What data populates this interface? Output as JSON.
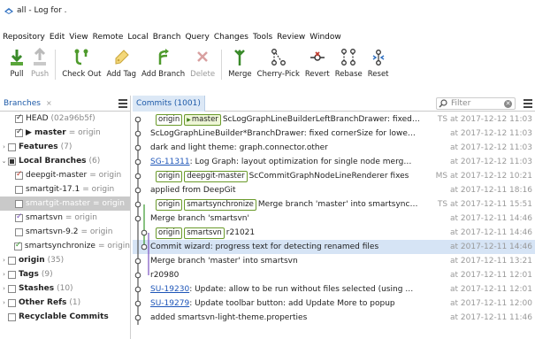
{
  "window": {
    "title": "all - Log for ."
  },
  "menu": [
    "Repository",
    "Edit",
    "View",
    "Remote",
    "Local",
    "Branch",
    "Query",
    "Changes",
    "Tools",
    "Review",
    "Window"
  ],
  "toolbar": [
    {
      "label": "Pull",
      "icon": "pull-icon",
      "disabled": false
    },
    {
      "label": "Push",
      "icon": "push-icon",
      "disabled": true
    },
    {
      "label": "Check Out",
      "icon": "checkout-icon",
      "disabled": false
    },
    {
      "label": "Add Tag",
      "icon": "tag-icon",
      "disabled": false
    },
    {
      "label": "Add Branch",
      "icon": "branch-icon",
      "disabled": false
    },
    {
      "label": "Delete",
      "icon": "delete-icon",
      "disabled": true
    },
    {
      "label": "Merge",
      "icon": "merge-icon",
      "disabled": false
    },
    {
      "label": "Cherry-Pick",
      "icon": "cherry-pick-icon",
      "disabled": false
    },
    {
      "label": "Revert",
      "icon": "revert-icon",
      "disabled": false
    },
    {
      "label": "Rebase",
      "icon": "rebase-icon",
      "disabled": false
    },
    {
      "label": "Reset",
      "icon": "reset-icon",
      "disabled": false
    }
  ],
  "branches": {
    "tab_label": "Branches",
    "close": "×",
    "items": [
      {
        "arrow": "",
        "check": "on",
        "color": "",
        "name": "HEAD",
        "sub": "(02a96b5f)",
        "bold": false,
        "indent": 1
      },
      {
        "arrow": "",
        "check": "on",
        "color": "",
        "name": "▶ master",
        "sub": "= origin",
        "bold": true,
        "indent": 1
      },
      {
        "arrow": "›",
        "check": "off",
        "color": "",
        "name": "Features",
        "sub": "(7)",
        "bold": true,
        "indent": 0
      },
      {
        "arrow": "⌄",
        "check": "mixed",
        "color": "",
        "name": "Local Branches",
        "sub": "(6)",
        "bold": true,
        "indent": 0
      },
      {
        "arrow": "",
        "check": "on",
        "color": "red",
        "name": "deepgit-master",
        "sub": "= origin",
        "bold": false,
        "indent": 1
      },
      {
        "arrow": "",
        "check": "off",
        "color": "",
        "name": "smartgit-17.1",
        "sub": "= origin",
        "bold": false,
        "indent": 1
      },
      {
        "arrow": "",
        "check": "off",
        "color": "",
        "name": "smartgit-master",
        "sub": "= origin",
        "bold": false,
        "indent": 1,
        "selected": true
      },
      {
        "arrow": "",
        "check": "on",
        "color": "purple",
        "name": "smartsvn",
        "sub": "= origin",
        "bold": false,
        "indent": 1
      },
      {
        "arrow": "",
        "check": "off",
        "color": "",
        "name": "smartsvn-9.2",
        "sub": "= origin",
        "bold": false,
        "indent": 1
      },
      {
        "arrow": "",
        "check": "on",
        "color": "green",
        "name": "smartsynchronize",
        "sub": "= origin",
        "bold": false,
        "indent": 1
      },
      {
        "arrow": "›",
        "check": "off",
        "color": "",
        "name": "origin",
        "sub": "(35)",
        "bold": true,
        "indent": 0
      },
      {
        "arrow": "›",
        "check": "off",
        "color": "",
        "name": "Tags",
        "sub": "(9)",
        "bold": true,
        "indent": 0
      },
      {
        "arrow": "›",
        "check": "off",
        "color": "",
        "name": "Stashes",
        "sub": "(10)",
        "bold": true,
        "indent": 0
      },
      {
        "arrow": "›",
        "check": "off",
        "color": "",
        "name": "Other Refs",
        "sub": "(1)",
        "bold": true,
        "indent": 0
      },
      {
        "arrow": "",
        "check": "off",
        "color": "",
        "name": "Recyclable Commits",
        "sub": "",
        "bold": true,
        "indent": 0
      }
    ]
  },
  "commits": {
    "tab_label": "Commits (1001)",
    "filter_placeholder": "Filter",
    "rows": [
      {
        "refs": [
          {
            "t": "origin",
            "c": false
          },
          {
            "t": "master",
            "c": true
          }
        ],
        "id": "",
        "msg": "ScLogGraphLineBuilderLeftBranchDrawer: fixed size on Linux",
        "when": "TS at 2017-12-12 11:03",
        "hl": false
      },
      {
        "refs": [],
        "id": "",
        "msg": "ScLogGraphLineBuilder*BranchDrawer: fixed cornerSize for lower resolutions",
        "when": "at 2017-12-12 11:03",
        "hl": false
      },
      {
        "refs": [],
        "id": "",
        "msg": "dark and light theme: graph.connector.other",
        "when": "at 2017-12-12 11:03",
        "hl": false
      },
      {
        "refs": [],
        "id": "SG-11311",
        "msg": ": Log Graph: layout optimization for single node merge-forks",
        "when": "at 2017-12-12 11:03",
        "hl": false
      },
      {
        "refs": [
          {
            "t": "origin",
            "c": false
          },
          {
            "t": "deepgit-master",
            "c": false
          }
        ],
        "id": "",
        "msg": "ScCommitGraphNodeLineRenderer fixes",
        "when": "MS at 2017-12-12 10:21",
        "hl": false
      },
      {
        "refs": [],
        "id": "",
        "msg": "applied from DeepGit",
        "when": "at 2017-12-11 18:16",
        "hl": false
      },
      {
        "refs": [
          {
            "t": "origin",
            "c": false
          },
          {
            "t": "smartsynchronize",
            "c": false
          }
        ],
        "id": "",
        "msg": "Merge branch 'master' into smartsynchronize (r15463)",
        "when": "TS at 2017-12-11 15:51",
        "hl": false
      },
      {
        "refs": [],
        "id": "",
        "msg": "Merge branch 'smartsvn'",
        "when": "at 2017-12-11 14:46",
        "hl": false
      },
      {
        "refs": [
          {
            "t": "origin",
            "c": false
          },
          {
            "t": "smartsvn",
            "c": false
          }
        ],
        "id": "",
        "msg": "r21021",
        "when": "at 2017-12-11 14:46",
        "hl": false
      },
      {
        "refs": [],
        "id": "",
        "msg": "Commit wizard: progress text for detecting renamed files",
        "when": "at 2017-12-11 14:46",
        "hl": true
      },
      {
        "refs": [],
        "id": "",
        "msg": "Merge branch 'master' into smartsvn",
        "when": "at 2017-12-11 13:21",
        "hl": false
      },
      {
        "refs": [],
        "id": "",
        "msg": "r20980",
        "when": "at 2017-12-11 12:01",
        "hl": false
      },
      {
        "refs": [],
        "id": "SU-19230",
        "msg": ": Update: allow to be run without files selected (using directory...",
        "when": "at 2017-12-11 12:01",
        "hl": false
      },
      {
        "refs": [],
        "id": "SU-19279",
        "msg": ": Update toolbar button: add Update More to popup",
        "when": "at 2017-12-11 12:00",
        "hl": false
      },
      {
        "refs": [],
        "id": "",
        "msg": "added smartsvn-light-theme.properties",
        "when": "at 2017-12-11 11:46",
        "hl": false
      }
    ]
  },
  "colors": {
    "accent": "#1d5aa8",
    "green": "#3a9a2e",
    "purple": "#7b52c0",
    "red": "#c0392b",
    "highlight": "#d6e4f5"
  }
}
